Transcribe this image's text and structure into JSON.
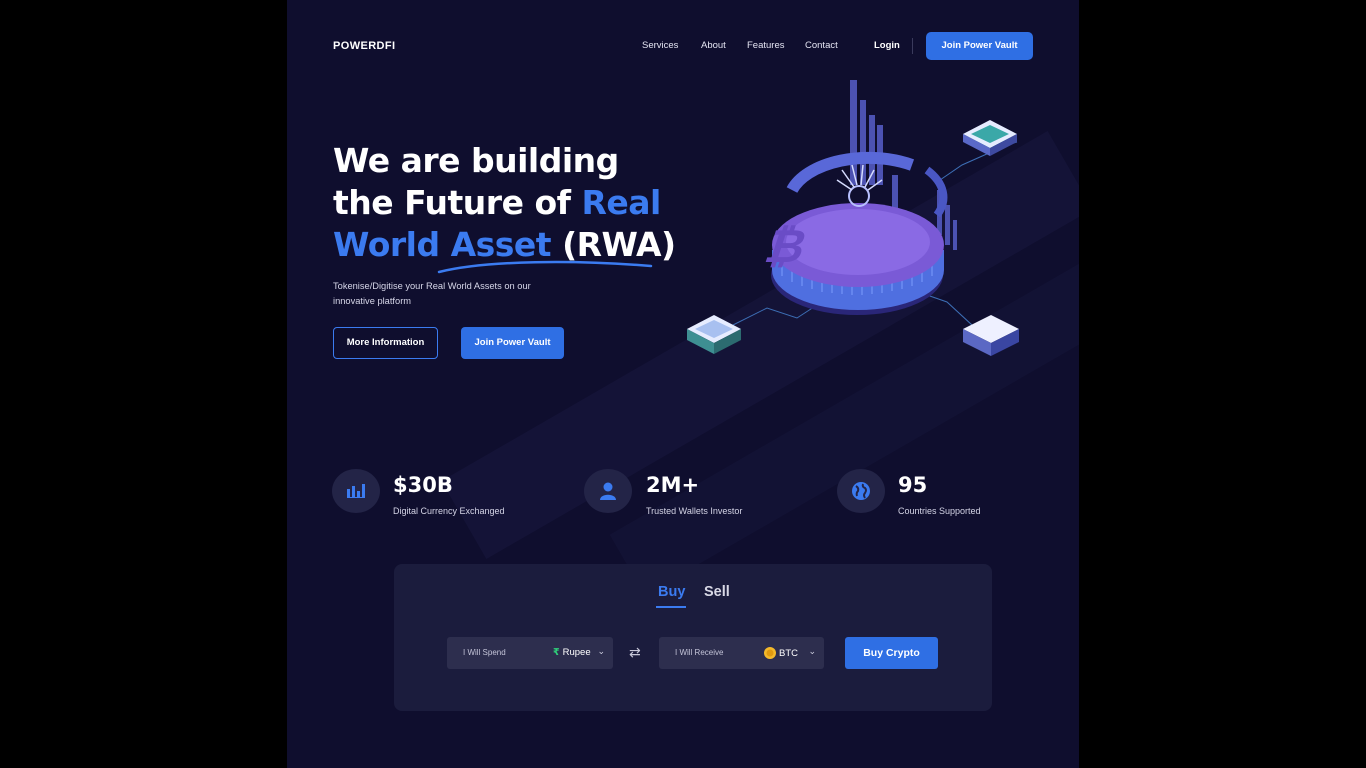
{
  "brand": "POWERDFI",
  "nav": {
    "services": "Services",
    "about": "About",
    "features": "Features",
    "contact": "Contact",
    "login": "Login",
    "join": "Join Power Vault"
  },
  "hero": {
    "line1": "We are building",
    "line2_a": "the Future of ",
    "line2_b": "Real",
    "line3_a": "World Asset",
    "line3_b": " (RWA)",
    "subtitle": "Tokenise/Digitise your Real World Assets on our innovative platform",
    "more_info": "More Information",
    "join": "Join Power Vault"
  },
  "stats": [
    {
      "value": "$30B",
      "label": "Digital Currency Exchanged",
      "icon": "bar-chart-icon"
    },
    {
      "value": "2M+",
      "label": "Trusted Wallets Investor",
      "icon": "user-icon"
    },
    {
      "value": "95",
      "label": "Countries Supported",
      "icon": "globe-icon"
    }
  ],
  "trade": {
    "tab_buy": "Buy",
    "tab_sell": "Sell",
    "spend_label": "I Will Spend",
    "spend_currency": "Rupee",
    "spend_symbol": "₹",
    "receive_label": "I Will Receive",
    "receive_currency": "BTC",
    "buy_button": "Buy Crypto"
  },
  "colors": {
    "background": "#0f0e2e",
    "accent": "#2f6fe4",
    "card": "#1b1c3d"
  }
}
